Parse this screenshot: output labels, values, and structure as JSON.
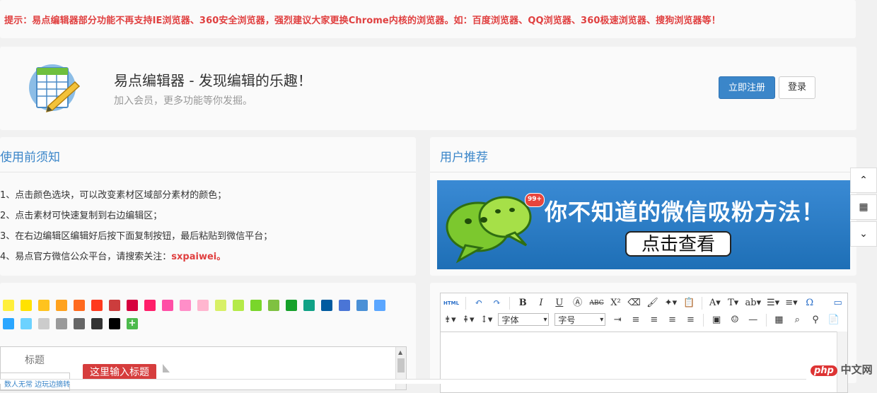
{
  "notice": "提示：易点编辑器部分功能不再支持IE浏览器、360安全浏览器，强烈建议大家更换Chrome内核的浏览器。如：百度浏览器、QQ浏览器、360极速浏览器、搜狗浏览器等！",
  "hero": {
    "title": "易点编辑器 - 发现编辑的乐趣！",
    "subtitle": "加入会员，更多功能等你发掘。",
    "register_label": "立即注册",
    "login_label": "登录"
  },
  "notes": {
    "title": "使用前须知",
    "items": [
      "1、点击颜色选块，可以改变素材区域部分素材的颜色；",
      "2、点击素材可快速复制到右边编辑区；",
      "3、在右边编辑区编辑好后按下面复制按钮，最后粘贴到微信平台；",
      "4、易点官方微信公众平台，请搜索关注："
    ],
    "account": "sxpaiwei",
    "account_suffix": "。"
  },
  "recommend": {
    "title": "用户推荐",
    "banner_text": "你不知道的微信吸粉方法！",
    "banner_button": "点击查看",
    "badge": "99+"
  },
  "palette": {
    "colors": [
      "#ffef3b",
      "#ffe200",
      "#ffc31e",
      "#ffa21e",
      "#ff6a1e",
      "#ff3a1e",
      "#cc3d3d",
      "#d6003e",
      "#ff1e6a",
      "#ff4fa6",
      "#ff8ec8",
      "#ffb6cf",
      "#d8f066",
      "#b4ea48",
      "#79d62a",
      "#7fc141",
      "#16a12a",
      "#10a286",
      "#005aa0",
      "#4a75d6",
      "#4a90d6",
      "#5aa6ff",
      "#2aa6ff",
      "#6cd2ff",
      "#cccccc",
      "#9a9a9a",
      "#666666",
      "#333333",
      "#000000"
    ],
    "plus_label": "+",
    "title_label": "标题",
    "title_placeholder": "这里输入标题"
  },
  "editor": {
    "font_select": "字体",
    "size_select": "字号",
    "html_label": "HTML"
  },
  "side_tools": {
    "up_icon": "chevron-up-icon",
    "qr_icon": "qr-code-icon",
    "down_icon": "chevron-down-icon"
  },
  "footer_link": "数人无常 边玩边摘转",
  "watermark": {
    "php": "php",
    "cn": "中文网"
  }
}
